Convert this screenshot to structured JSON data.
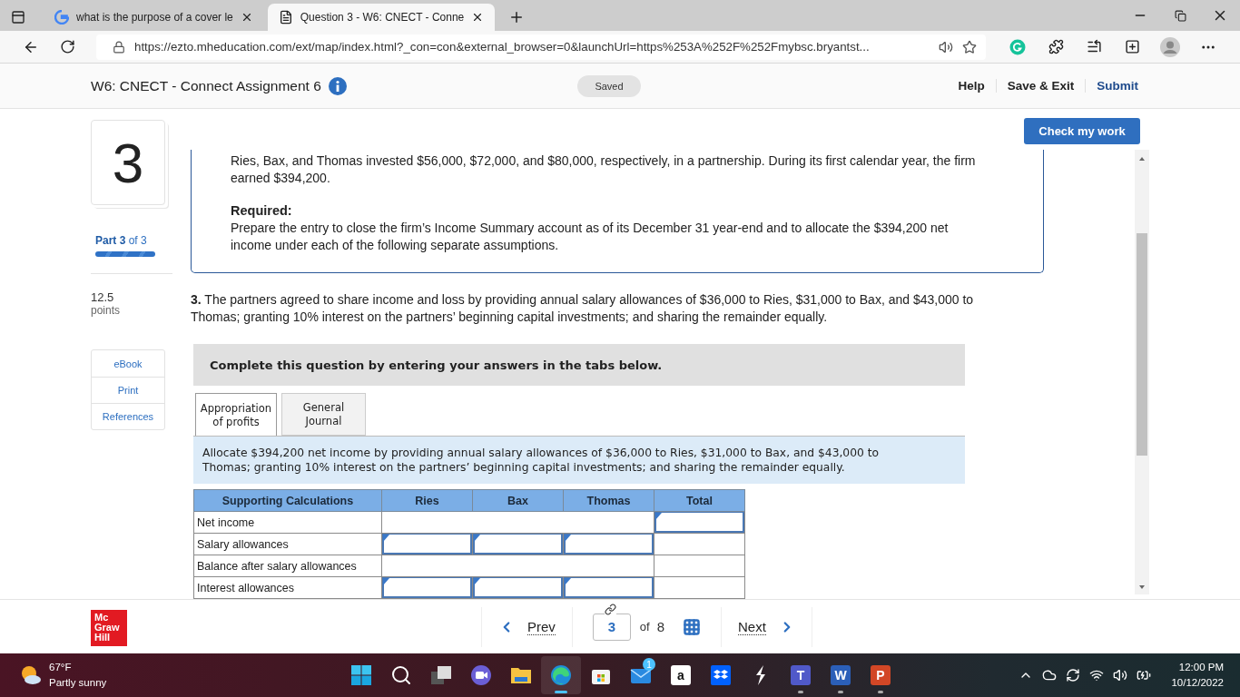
{
  "browser": {
    "tabs": [
      {
        "title": "what is the purpose of a cover le",
        "kind": "google",
        "selected": false
      },
      {
        "title": "Question 3 - W6: CNECT - Conne",
        "kind": "page",
        "selected": true
      }
    ],
    "url": "https://ezto.mheducation.com/ext/map/index.html?_con=con&external_browser=0&launchUrl=https%253A%252F%252Fmybsc.bryantst..."
  },
  "header": {
    "title": "W6: CNECT - Connect Assignment 6",
    "status": "Saved",
    "links": [
      {
        "label": "Help",
        "kind": "plain"
      },
      {
        "label": "Save & Exit",
        "kind": "plain"
      },
      {
        "label": "Submit",
        "kind": "primary"
      }
    ]
  },
  "sidebar": {
    "question_number": "3",
    "part": "**Part 3** of 3",
    "progress": {
      "level": 1
    },
    "points_value": "12.5",
    "points_label": "points",
    "resources": [
      "eBook",
      "Print",
      "References"
    ]
  },
  "check_button": "Check my work",
  "problem": {
    "intro": "Ries, Bax, and Thomas invested $56,000, $72,000, and $80,000, respectively, in a partnership. During its first calendar year, the firm earned $394,200.",
    "required_label": "Required:",
    "required_text": "Prepare the entry to close the firm’s Income Summary account as of its December 31 year-end and to allocate the $394,200 net income under each of the following separate assumptions."
  },
  "question": "**3.** The partners agreed to share income and loss by providing annual salary allowances of $36,000 to Ries, $31,000 to Bax, and $43,000 to Thomas; granting 10% interest on the partners’ beginning capital investments; and sharing the remainder equally.",
  "instruction": "Complete this question by entering your answers in the tabs below.",
  "answer_tabs": [
    {
      "label": "Appropriation of profits",
      "selected": true
    },
    {
      "label": "General Journal",
      "selected": false
    }
  ],
  "task_text": "Allocate $394,200 net income by providing annual salary allowances of $36,000 to Ries, $31,000 to Bax, and $43,000 to Thomas; granting 10% interest on the partners’ beginning capital investments; and sharing the remainder equally.",
  "table": {
    "columns": [
      "Supporting Calculations",
      "Ries",
      "Bax",
      "Thomas",
      "Total"
    ],
    "rows": [
      {
        "label": "Net income",
        "cells": [
          {
            "kind": "wide"
          },
          {
            "kind": "input"
          }
        ]
      },
      {
        "label": "Salary allowances",
        "cells": [
          {
            "kind": "input"
          },
          {
            "kind": "input"
          },
          {
            "kind": "input"
          },
          {
            "kind": "empty"
          }
        ]
      },
      {
        "label": "Balance after salary allowances",
        "cells": [
          {
            "kind": "wide"
          },
          {
            "kind": "empty"
          }
        ]
      },
      {
        "label": "Interest allowances",
        "cells": [
          {
            "kind": "input"
          },
          {
            "kind": "input"
          },
          {
            "kind": "input"
          },
          {
            "kind": "empty"
          }
        ]
      }
    ]
  },
  "footer": {
    "logo": [
      "Mc",
      "Graw",
      "Hill"
    ],
    "prev": "Prev",
    "current": "3",
    "of": "of",
    "total": "8",
    "next": "Next"
  },
  "taskbar": {
    "weather": {
      "temp": "67°F",
      "condition": "Partly sunny"
    },
    "apps": [
      {
        "kind": "start",
        "running": false
      },
      {
        "kind": "search",
        "running": false
      },
      {
        "kind": "taskview",
        "running": false
      },
      {
        "kind": "chat",
        "running": false
      },
      {
        "kind": "files",
        "running": false
      },
      {
        "kind": "edge",
        "running": true
      },
      {
        "kind": "store",
        "running": false
      },
      {
        "kind": "mail",
        "running": false,
        "badge": "1"
      },
      {
        "kind": "amazon",
        "running": false,
        "glyph": "a"
      },
      {
        "kind": "dropbox",
        "running": false
      },
      {
        "kind": "bolt",
        "running": false
      },
      {
        "kind": "teams",
        "running": true,
        "glyph": "T"
      },
      {
        "kind": "word",
        "running": true,
        "glyph": "W"
      },
      {
        "kind": "powerpoint",
        "running": true,
        "glyph": "P"
      }
    ],
    "time": "12:00 PM",
    "date": "10/12/2022"
  }
}
